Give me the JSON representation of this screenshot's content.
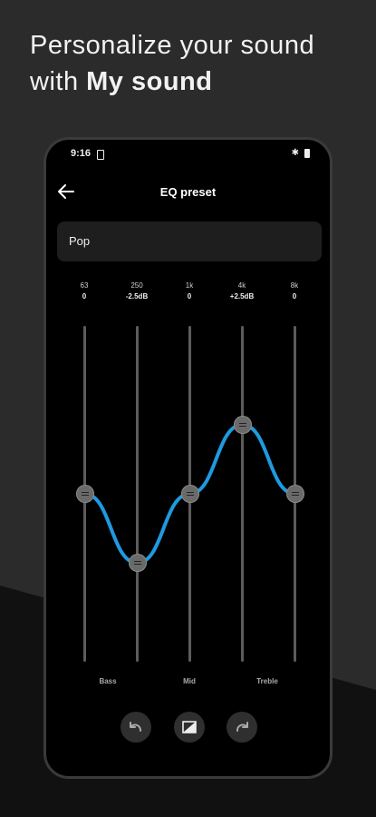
{
  "headline": {
    "line1": "Personalize your sound",
    "line2_prefix": "with ",
    "line2_bold": "My sound"
  },
  "status": {
    "time": "9:16"
  },
  "screen": {
    "title": "EQ preset"
  },
  "preset": {
    "value": "Pop"
  },
  "bands": [
    {
      "freq": "63",
      "value": "0",
      "db": 0
    },
    {
      "freq": "250",
      "value": "-2.5dB",
      "db": -2.5
    },
    {
      "freq": "1k",
      "value": "0",
      "db": 0
    },
    {
      "freq": "4k",
      "value": "+2.5dB",
      "db": 2.5
    },
    {
      "freq": "8k",
      "value": "0",
      "db": 0
    }
  ],
  "zones": {
    "bass": "Bass",
    "mid": "Mid",
    "treble": "Treble"
  },
  "controls": [
    "undo-icon",
    "compare-icon",
    "redo-icon"
  ],
  "colors": {
    "curve": "#1e9ae0",
    "background": "#2b2b2b"
  }
}
